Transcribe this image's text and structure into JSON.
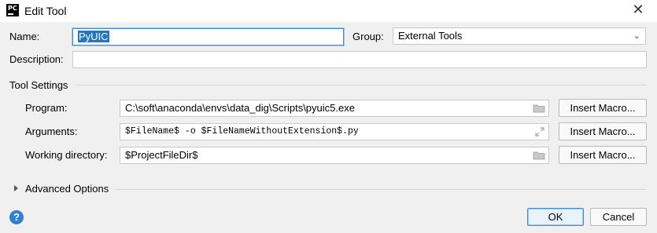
{
  "window": {
    "title": "Edit Tool",
    "icon_text": "PC",
    "close_glyph": "✕"
  },
  "form": {
    "name_label": "Name:",
    "name_value": "PyUIC",
    "group_label": "Group:",
    "group_value": "External Tools",
    "description_label": "Description:",
    "description_value": ""
  },
  "tool_settings": {
    "title": "Tool Settings",
    "program_label": "Program:",
    "program_value": "C:\\soft\\anaconda\\envs\\data_dig\\Scripts\\pyuic5.exe",
    "arguments_label": "Arguments:",
    "arguments_value": "$FileName$ -o $FileNameWithoutExtension$.py",
    "working_dir_label": "Working directory:",
    "working_dir_value": "$ProjectFileDir$",
    "insert_macro_label": "Insert Macro..."
  },
  "advanced": {
    "title": "Advanced Options"
  },
  "footer": {
    "help_glyph": "?",
    "ok_label": "OK",
    "cancel_label": "Cancel"
  },
  "icons": {
    "app": "pycharm-icon",
    "folder": "folder-icon",
    "expand": "expand-icon",
    "dropdown": "chevron-down-icon",
    "help": "help-icon"
  },
  "colors": {
    "background": "#f0f0f0",
    "selection": "#2675bf",
    "focus_border": "#3d8fd6",
    "help_icon": "#2f80d1"
  }
}
